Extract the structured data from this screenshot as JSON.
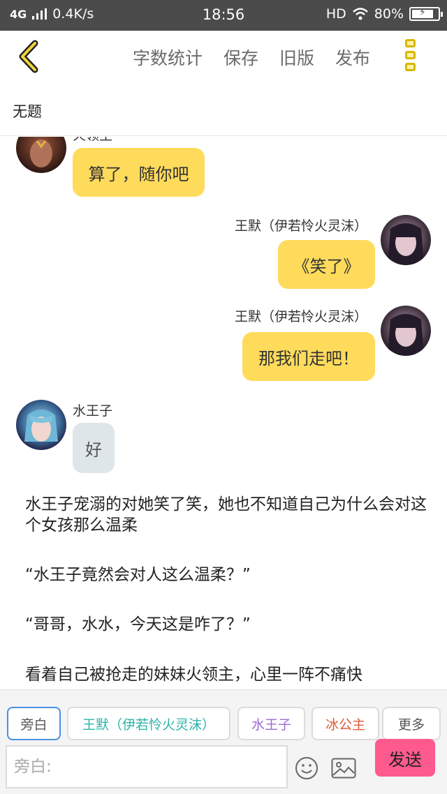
{
  "status_bar": {
    "network": "4G",
    "speed": "0.4K/s",
    "time": "18:56",
    "hd": "HD",
    "battery": "80%"
  },
  "toolbar": {
    "back_icon": "chevron-left-icon",
    "items": [
      "字数统计",
      "保存",
      "旧版",
      "发布"
    ],
    "menu_icon": "more-vertical-icon"
  },
  "title": "无题",
  "chat": {
    "messages": [
      {
        "speaker": "火领主",
        "text": "算了，随你吧",
        "side": "left",
        "style": "yellow"
      },
      {
        "speaker": "王默（伊若怜火灵沫）",
        "text": "《笑了》",
        "side": "right",
        "style": "yellow"
      },
      {
        "speaker": "王默（伊若怜火灵沫）",
        "text": "那我们走吧！",
        "side": "right",
        "style": "yellow"
      },
      {
        "speaker": "水王子",
        "text": "好",
        "side": "left",
        "style": "gray"
      }
    ],
    "narration": [
      "水王子宠溺的对她笑了笑，她也不知道自己为什么会对这个女孩那么温柔",
      "“水王子竟然会对人这么温柔？”",
      "“哥哥，水水，今天这是咋了？”",
      "看着自己被抢走的妹妹火领主，心里一阵不痛快"
    ]
  },
  "characters": [
    {
      "label": "旁白",
      "color": "#555555",
      "active": true
    },
    {
      "label": "王默（伊若怜火灵沫）",
      "color": "#2bb5a8",
      "active": false
    },
    {
      "label": "水王子",
      "color": "#9b6ad0",
      "active": false
    },
    {
      "label": "冰公主",
      "color": "#e05a3a",
      "active": false
    },
    {
      "label": "更多",
      "color": "#555555",
      "active": false
    }
  ],
  "composer": {
    "placeholder": "旁白:",
    "emoji_icon": "smiley-icon",
    "image_icon": "image-icon",
    "send_label": "发送"
  },
  "colors": {
    "bubble_yellow": "#ffdb5c",
    "bubble_gray": "#dfe6ea",
    "send_button": "#ff5a8e",
    "accent_yellow": "#d9b600",
    "status_bar": "#4b4b4b"
  }
}
